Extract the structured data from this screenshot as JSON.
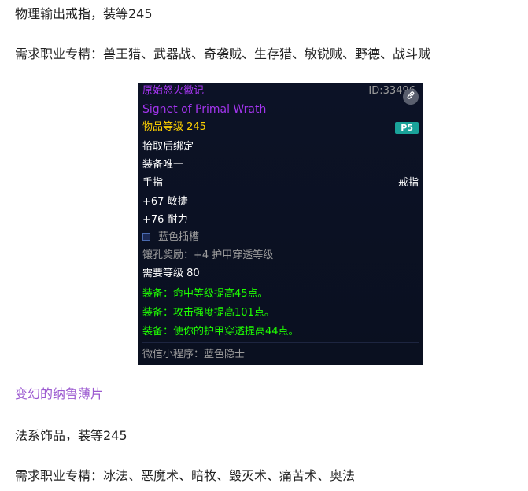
{
  "paragraphs": {
    "p1": "物理输出戒指，装等245",
    "p2": "需求职业专精：兽王猎、武器战、奇袭贼、生存猎、敏锐贼、野德、战斗贼",
    "p3": "变幻的纳鲁薄片",
    "p4": "法系饰品，装等245",
    "p5": "需求职业专精：冰法、恶魔术、暗牧、毁灭术、痛苦术、奥法"
  },
  "tooltip": {
    "name_cn": "原始怒火徽记",
    "id": "ID:33496",
    "name_en": "Signet of Primal Wrath",
    "item_level": "物品等级 245",
    "phase_badge": "P5",
    "bind": "拾取后绑定",
    "unique": "装备唯一",
    "slot": "手指",
    "type": "戒指",
    "stat1": "+67 敏捷",
    "stat2": "+76 耐力",
    "socket": "蓝色插槽",
    "socket_bonus": "镶孔奖励：+4 护甲穿透等级",
    "req_level": "需要等级 80",
    "equip1": "装备：命中等级提高45点。",
    "equip2": "装备：攻击强度提高101点。",
    "equip3": "装备：使你的护甲穿透提高44点。",
    "footer": "微信小程序：蓝色隐士"
  },
  "colors": {
    "epic": "#a335ee",
    "item_level": "#ffd100",
    "equip_effect": "#1eff00",
    "badge": "#1aa39a",
    "link_text": "#9b59d0"
  },
  "icons": {
    "link": "link-icon",
    "socket": "blue-socket-icon"
  }
}
